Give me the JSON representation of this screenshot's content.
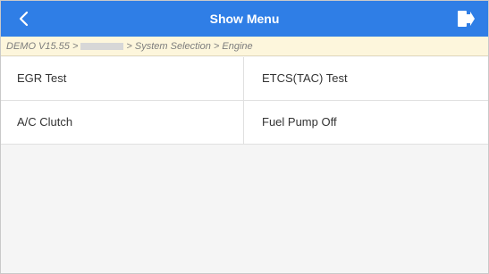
{
  "header": {
    "title": "Show Menu",
    "back_icon": "chevron-left-icon",
    "exit_icon": "exit-door-icon",
    "bg_color": "#2f7ee6"
  },
  "breadcrumb": {
    "part1": "DEMO V15.55 >",
    "part2": "> System Selection > Engine"
  },
  "menu": {
    "items": [
      {
        "label": "EGR Test"
      },
      {
        "label": "ETCS(TAC) Test"
      },
      {
        "label": "A/C Clutch"
      },
      {
        "label": "Fuel Pump Off"
      }
    ]
  }
}
